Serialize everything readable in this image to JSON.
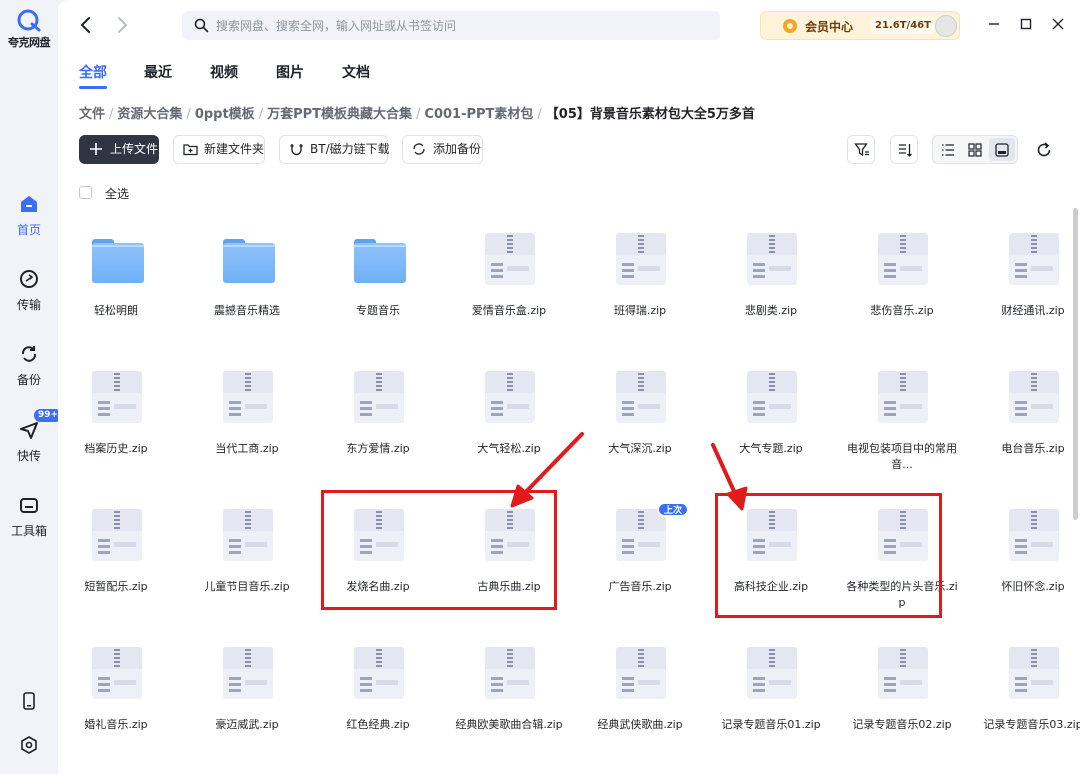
{
  "app": {
    "name": "夸克网盘"
  },
  "sidebar": {
    "items": [
      {
        "label": "首页",
        "icon": "home-icon",
        "active": true
      },
      {
        "label": "传输",
        "icon": "transfer-icon"
      },
      {
        "label": "备份",
        "icon": "backup-icon"
      },
      {
        "label": "快传",
        "icon": "quick-send-icon",
        "badge": "99+"
      },
      {
        "label": "工具箱",
        "icon": "toolbox-icon"
      }
    ]
  },
  "search": {
    "placeholder": "搜索网盘、搜索全网，输入网址或从书签访问"
  },
  "vip": {
    "label": "会员中心",
    "storage": "21.6T/46T"
  },
  "tabs": [
    "全部",
    "最近",
    "视频",
    "图片",
    "文档"
  ],
  "breadcrumb": [
    "文件",
    "资源大合集",
    "0ppt模板",
    "万套PPT模板典藏大合集",
    "C001-PPT素材包",
    "【05】背景音乐素材包大全5万多首"
  ],
  "toolbar": {
    "upload": "上传文件",
    "new_folder": "新建文件夹",
    "bt": "BT/磁力链下载",
    "backup": "添加备份"
  },
  "select_all": "全选",
  "files": [
    {
      "name": "轻松明朗",
      "type": "folder"
    },
    {
      "name": "震撼音乐精选",
      "type": "folder"
    },
    {
      "name": "专题音乐",
      "type": "folder"
    },
    {
      "name": "爱情音乐盒.zip",
      "type": "zip"
    },
    {
      "name": "班得瑞.zip",
      "type": "zip"
    },
    {
      "name": "悲剧类.zip",
      "type": "zip"
    },
    {
      "name": "悲伤音乐.zip",
      "type": "zip"
    },
    {
      "name": "财经通讯.zip",
      "type": "zip"
    },
    {
      "name": "档案历史.zip",
      "type": "zip"
    },
    {
      "name": "当代工商.zip",
      "type": "zip"
    },
    {
      "name": "东方爱情.zip",
      "type": "zip"
    },
    {
      "name": "大气轻松.zip",
      "type": "zip"
    },
    {
      "name": "大气深沉.zip",
      "type": "zip"
    },
    {
      "name": "大气专题.zip",
      "type": "zip"
    },
    {
      "name": "电视包装项目中的常用音...",
      "type": "zip"
    },
    {
      "name": "电台音乐.zip",
      "type": "zip"
    },
    {
      "name": "短暂配乐.zip",
      "type": "zip"
    },
    {
      "name": "儿童节目音乐.zip",
      "type": "zip"
    },
    {
      "name": "发烧名曲.zip",
      "type": "zip"
    },
    {
      "name": "古典乐曲.zip",
      "type": "zip"
    },
    {
      "name": "广告音乐.zip",
      "type": "zip",
      "badge": "上次"
    },
    {
      "name": "高科技企业.zip",
      "type": "zip"
    },
    {
      "name": "各种类型的片头音乐.zip",
      "type": "zip"
    },
    {
      "name": "怀旧怀念.zip",
      "type": "zip"
    },
    {
      "name": "婚礼音乐.zip",
      "type": "zip"
    },
    {
      "name": "豪迈威武.zip",
      "type": "zip"
    },
    {
      "name": "红色经典.zip",
      "type": "zip"
    },
    {
      "name": "经典欧美歌曲合辑.zip",
      "type": "zip"
    },
    {
      "name": "经典武侠歌曲.zip",
      "type": "zip"
    },
    {
      "name": "记录专题音乐01.zip",
      "type": "zip"
    },
    {
      "name": "记录专题音乐02.zip",
      "type": "zip"
    },
    {
      "name": "记录专题音乐03.zip",
      "type": "zip"
    }
  ],
  "colors": {
    "accent": "#3a6ef6",
    "annotation": "#e11b1b"
  }
}
